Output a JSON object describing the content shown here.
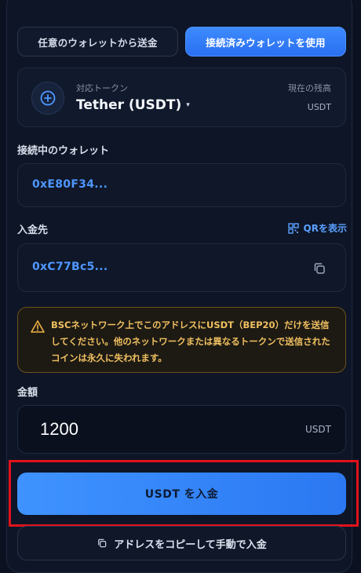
{
  "tabs": [
    {
      "label": "任意のウォレットから送金",
      "active": false
    },
    {
      "label": "接続済みウォレットを使用",
      "active": true
    }
  ],
  "token": {
    "label": "対応トークン",
    "name": "Tether (USDT)",
    "caret": "▾",
    "balance_label": "現在の残高",
    "balance_unit": "USDT"
  },
  "wallet": {
    "label": "接続中のウォレット",
    "address": "0xE80F34..."
  },
  "deposit": {
    "label": "入金先",
    "qr_link": "QRを表示",
    "address": "0xC77Bc5..."
  },
  "warning": {
    "text": "BSCネットワーク上でこのアドレスにUSDT（BEP20）だけを送信してください。他のネットワークまたは異なるトークンで送信されたコインは永久に失われます。"
  },
  "amount": {
    "label": "金額",
    "value": "1200",
    "unit": "USDT"
  },
  "actions": {
    "submit_label": "USDT を入金",
    "manual_label": "アドレスをコピーして手動で入金"
  },
  "colors": {
    "accent": "#2b78f2",
    "warning": "#f0c060",
    "highlight": "#e0121b",
    "background": "#0b1120"
  }
}
